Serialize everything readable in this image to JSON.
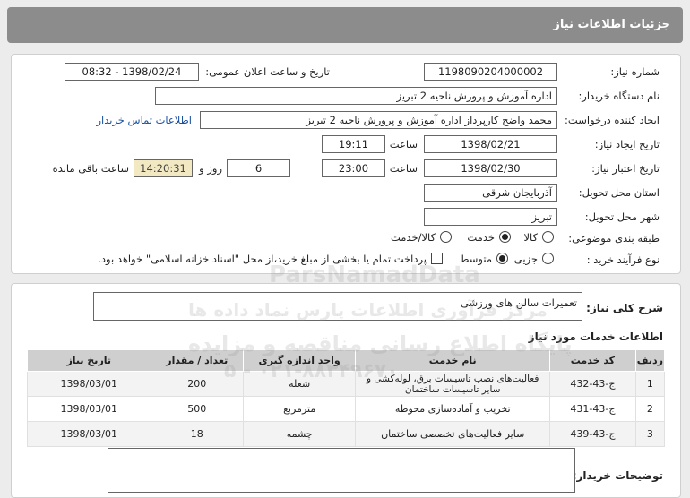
{
  "header": {
    "title": "جزئیات اطلاعات نیاز"
  },
  "form": {
    "need_number_label": "شماره نیاز:",
    "need_number": "1198090204000002",
    "announce_label": "تاریخ و ساعت اعلان عمومی:",
    "announce_value": "1398/02/24 - 08:32",
    "buyer_label": "نام دستگاه خریدار:",
    "buyer_value": "اداره آموزش و پرورش ناحیه 2 تبریز",
    "creator_label": "ایجاد کننده درخواست:",
    "creator_value": "محمد واضح کارپرداز اداره آموزش و پرورش ناحیه 2 تبریز",
    "contact_link": "اطلاعات تماس خریدار",
    "created_label": "تاریخ ایجاد نیاز:",
    "created_date": "1398/02/21",
    "time_label": "ساعت",
    "created_time": "19:11",
    "valid_label": "تاریخ اعتبار نیاز:",
    "valid_date": "1398/02/30",
    "valid_time": "23:00",
    "days_value": "6",
    "days_label": "روز و",
    "remaining_time": "14:20:31",
    "remaining_label": "ساعت باقی مانده",
    "province_label": "استان محل تحویل:",
    "province_value": "آذربایجان شرقی",
    "city_label": "شهر محل تحویل:",
    "city_value": "تبریز",
    "category_label": "طبقه بندی موضوعی:",
    "category_options": [
      "کالا",
      "خدمت",
      "کالا/خدمت"
    ],
    "category_selected": "خدمت",
    "process_label": "نوع فرآیند خرید :",
    "process_options": [
      "جزیی",
      "متوسط"
    ],
    "process_selected": "متوسط",
    "payment_note": "پرداخت تمام یا بخشی از مبلغ خرید،از محل \"اسناد خزانه اسلامی\" خواهد بود."
  },
  "summary": {
    "label": "شرح کلی نیاز:",
    "value": "تعمیرات سالن های ورزشی"
  },
  "services": {
    "title": "اطلاعات خدمات مورد نیاز",
    "columns": [
      "ردیف",
      "کد خدمت",
      "نام خدمت",
      "واحد اندازه گیری",
      "تعداد / مقدار",
      "تاریخ نیاز"
    ],
    "rows": [
      {
        "idx": "1",
        "code": "ج-43-432",
        "name": "فعالیت‌های نصب تاسیسات برق، لوله‌کشی و سایر تاسیسات ساختمان",
        "unit": "شعله",
        "qty": "200",
        "date": "1398/03/01"
      },
      {
        "idx": "2",
        "code": "ج-43-431",
        "name": "تخریب و آماده‌سازی محوطه",
        "unit": "مترمربع",
        "qty": "500",
        "date": "1398/03/01"
      },
      {
        "idx": "3",
        "code": "ج-43-439",
        "name": "سایر فعالیت‌های تخصصی ساختمان",
        "unit": "چشمه",
        "qty": "18",
        "date": "1398/03/01"
      }
    ]
  },
  "buyer_notes": {
    "label": "توضیحات خریدار:"
  },
  "watermarks": {
    "line1": "ParsNamadData",
    "line2": "مرکز فرآوری اطلاعات پارس نماد داده ها",
    "line3": "پایگاه اطلاع رسانی مناقصه و مزایده",
    "line4": "۰۲۱-۸۸۳۴۹۶۷۰ - ۵"
  }
}
